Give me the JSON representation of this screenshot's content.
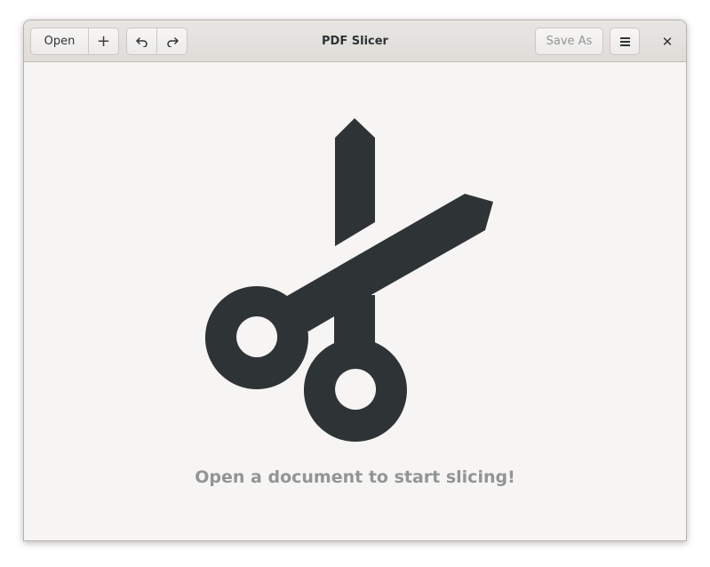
{
  "header": {
    "title": "PDF Slicer",
    "open_label": "Open",
    "add_label": "+",
    "save_as_label": "Save As",
    "close_label": "✕"
  },
  "main": {
    "placeholder_text": "Open a document to start slicing!"
  },
  "icons": {
    "add": "plus-icon",
    "undo": "undo-icon",
    "redo": "redo-icon",
    "menu": "hamburger-menu-icon",
    "close": "close-icon",
    "illustration": "scissors-icon"
  },
  "colors": {
    "window_bg": "#f6f5f4",
    "headerbar_bg": "#e1dedb",
    "icon_dark": "#2e3436",
    "placeholder_text": "#929595",
    "disabled_text": "#929595"
  }
}
